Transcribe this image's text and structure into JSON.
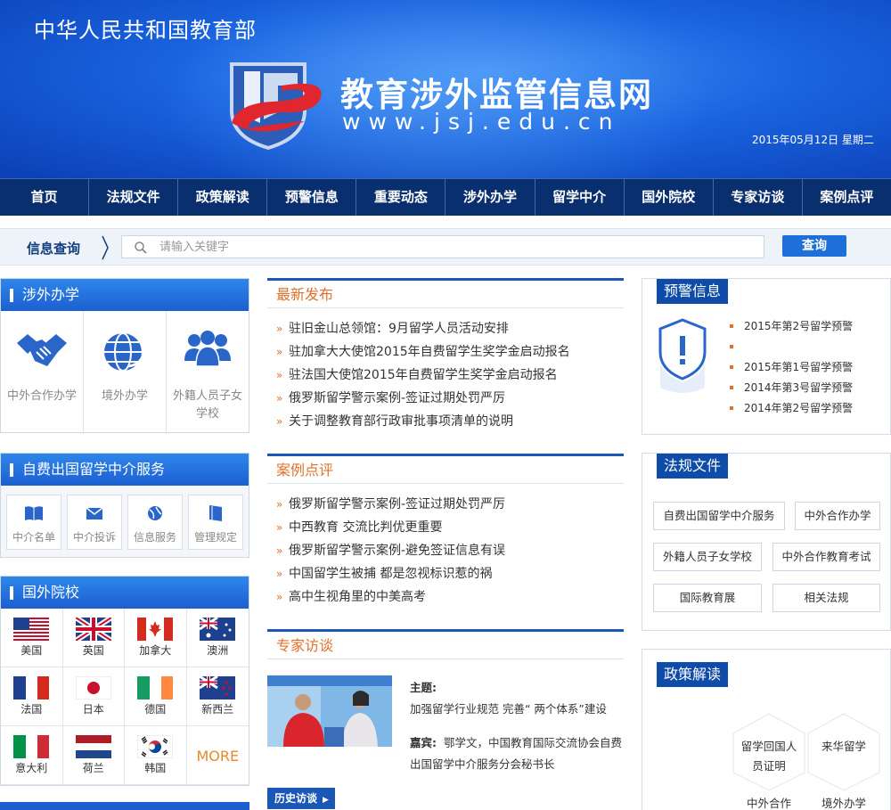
{
  "header": {
    "ministry": "中华人民共和国教育部",
    "site_title": "教育涉外监管信息网",
    "site_url": "www.jsj.edu.cn",
    "date": "2015年05月12日  星期二"
  },
  "nav": [
    "首页",
    "法规文件",
    "政策解读",
    "预警信息",
    "重要动态",
    "涉外办学",
    "留学中介",
    "国外院校",
    "专家访谈",
    "案例点评"
  ],
  "search": {
    "label": "信息查询",
    "placeholder": "请输入关键字",
    "button": "查询"
  },
  "foreign_school": {
    "title": "涉外办学",
    "items": [
      "中外合作办学",
      "境外办学",
      "外籍人员子女学校"
    ]
  },
  "agency": {
    "title": "自费出国留学中介服务",
    "items": [
      "中介名单",
      "中介投诉",
      "信息服务",
      "管理规定"
    ]
  },
  "foreign_univ": {
    "title": "国外院校",
    "countries": [
      "美国",
      "英国",
      "加拿大",
      "澳洲",
      "法国",
      "日本",
      "德国",
      "新西兰",
      "意大利",
      "荷兰",
      "韩国"
    ],
    "more": "MORE"
  },
  "latest": {
    "title": "最新发布",
    "items": [
      "驻旧金山总领馆：9月留学人员活动安排",
      "驻加拿大大使馆2015年自费留学生奖学金启动报名",
      "驻法国大使馆2015年自费留学生奖学金启动报名",
      "俄罗斯留学警示案例-签证过期处罚严厉",
      "关于调整教育部行政审批事项清单的说明"
    ]
  },
  "cases": {
    "title": "案例点评",
    "items": [
      "俄罗斯留学警示案例-签证过期处罚严厉",
      "中西教育 交流比判优更重要",
      "俄罗斯留学警示案例-避免签证信息有误",
      "中国留学生被捕 都是忽视标识惹的祸",
      "高中生视角里的中美高考"
    ]
  },
  "interview": {
    "title": "专家访谈",
    "topic_label": "主题:",
    "topic": "加强留学行业规范 完善“ 两个体系”建设",
    "guest_label": "嘉宾:",
    "guest_line1": "鄂学文，中国教育国际交流协会自费",
    "guest_line2": "出国留学中介服务分会秘书长",
    "history": "历史访谈"
  },
  "warning": {
    "title": "预警信息",
    "items": [
      "2015年第2号留学预警",
      "",
      "2015年第1号留学预警",
      "2014年第3号留学预警",
      "2014年第2号留学预警"
    ]
  },
  "laws": {
    "title": "法规文件",
    "items": [
      "自费出国留学中介服务",
      "中外合作办学",
      "外籍人员子女学校",
      "中外合作教育考试",
      "国际教育展",
      "相关法规"
    ]
  },
  "policy": {
    "title": "政策解读",
    "items": [
      "留学回国人员证明",
      "来华留学",
      "中外合作",
      "境外办学"
    ]
  }
}
